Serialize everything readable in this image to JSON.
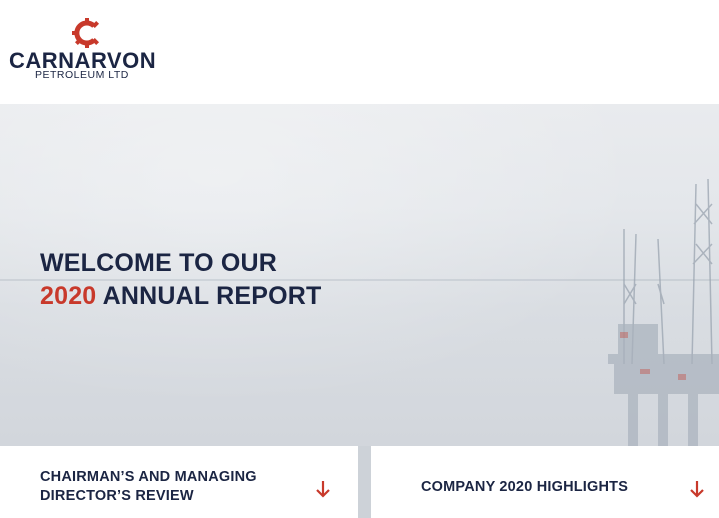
{
  "brand": {
    "name": "CARNARVON",
    "subtitle": "PETROLEUM LTD",
    "logo_icon": "gear-c-logo-icon",
    "accent_color": "#c8392b",
    "navy_color": "#1b2543"
  },
  "hero": {
    "title_line1": "WELCOME TO OUR",
    "year": "2020",
    "title_line2_rest": " ANNUAL REPORT",
    "background": "offshore-oil-rig-photo"
  },
  "cards": [
    {
      "label": "CHAIRMAN’S AND MANAGING DIRECTOR’S REVIEW",
      "icon": "arrow-down-icon"
    },
    {
      "label": "COMPANY 2020 HIGHLIGHTS",
      "icon": "arrow-down-icon"
    }
  ]
}
